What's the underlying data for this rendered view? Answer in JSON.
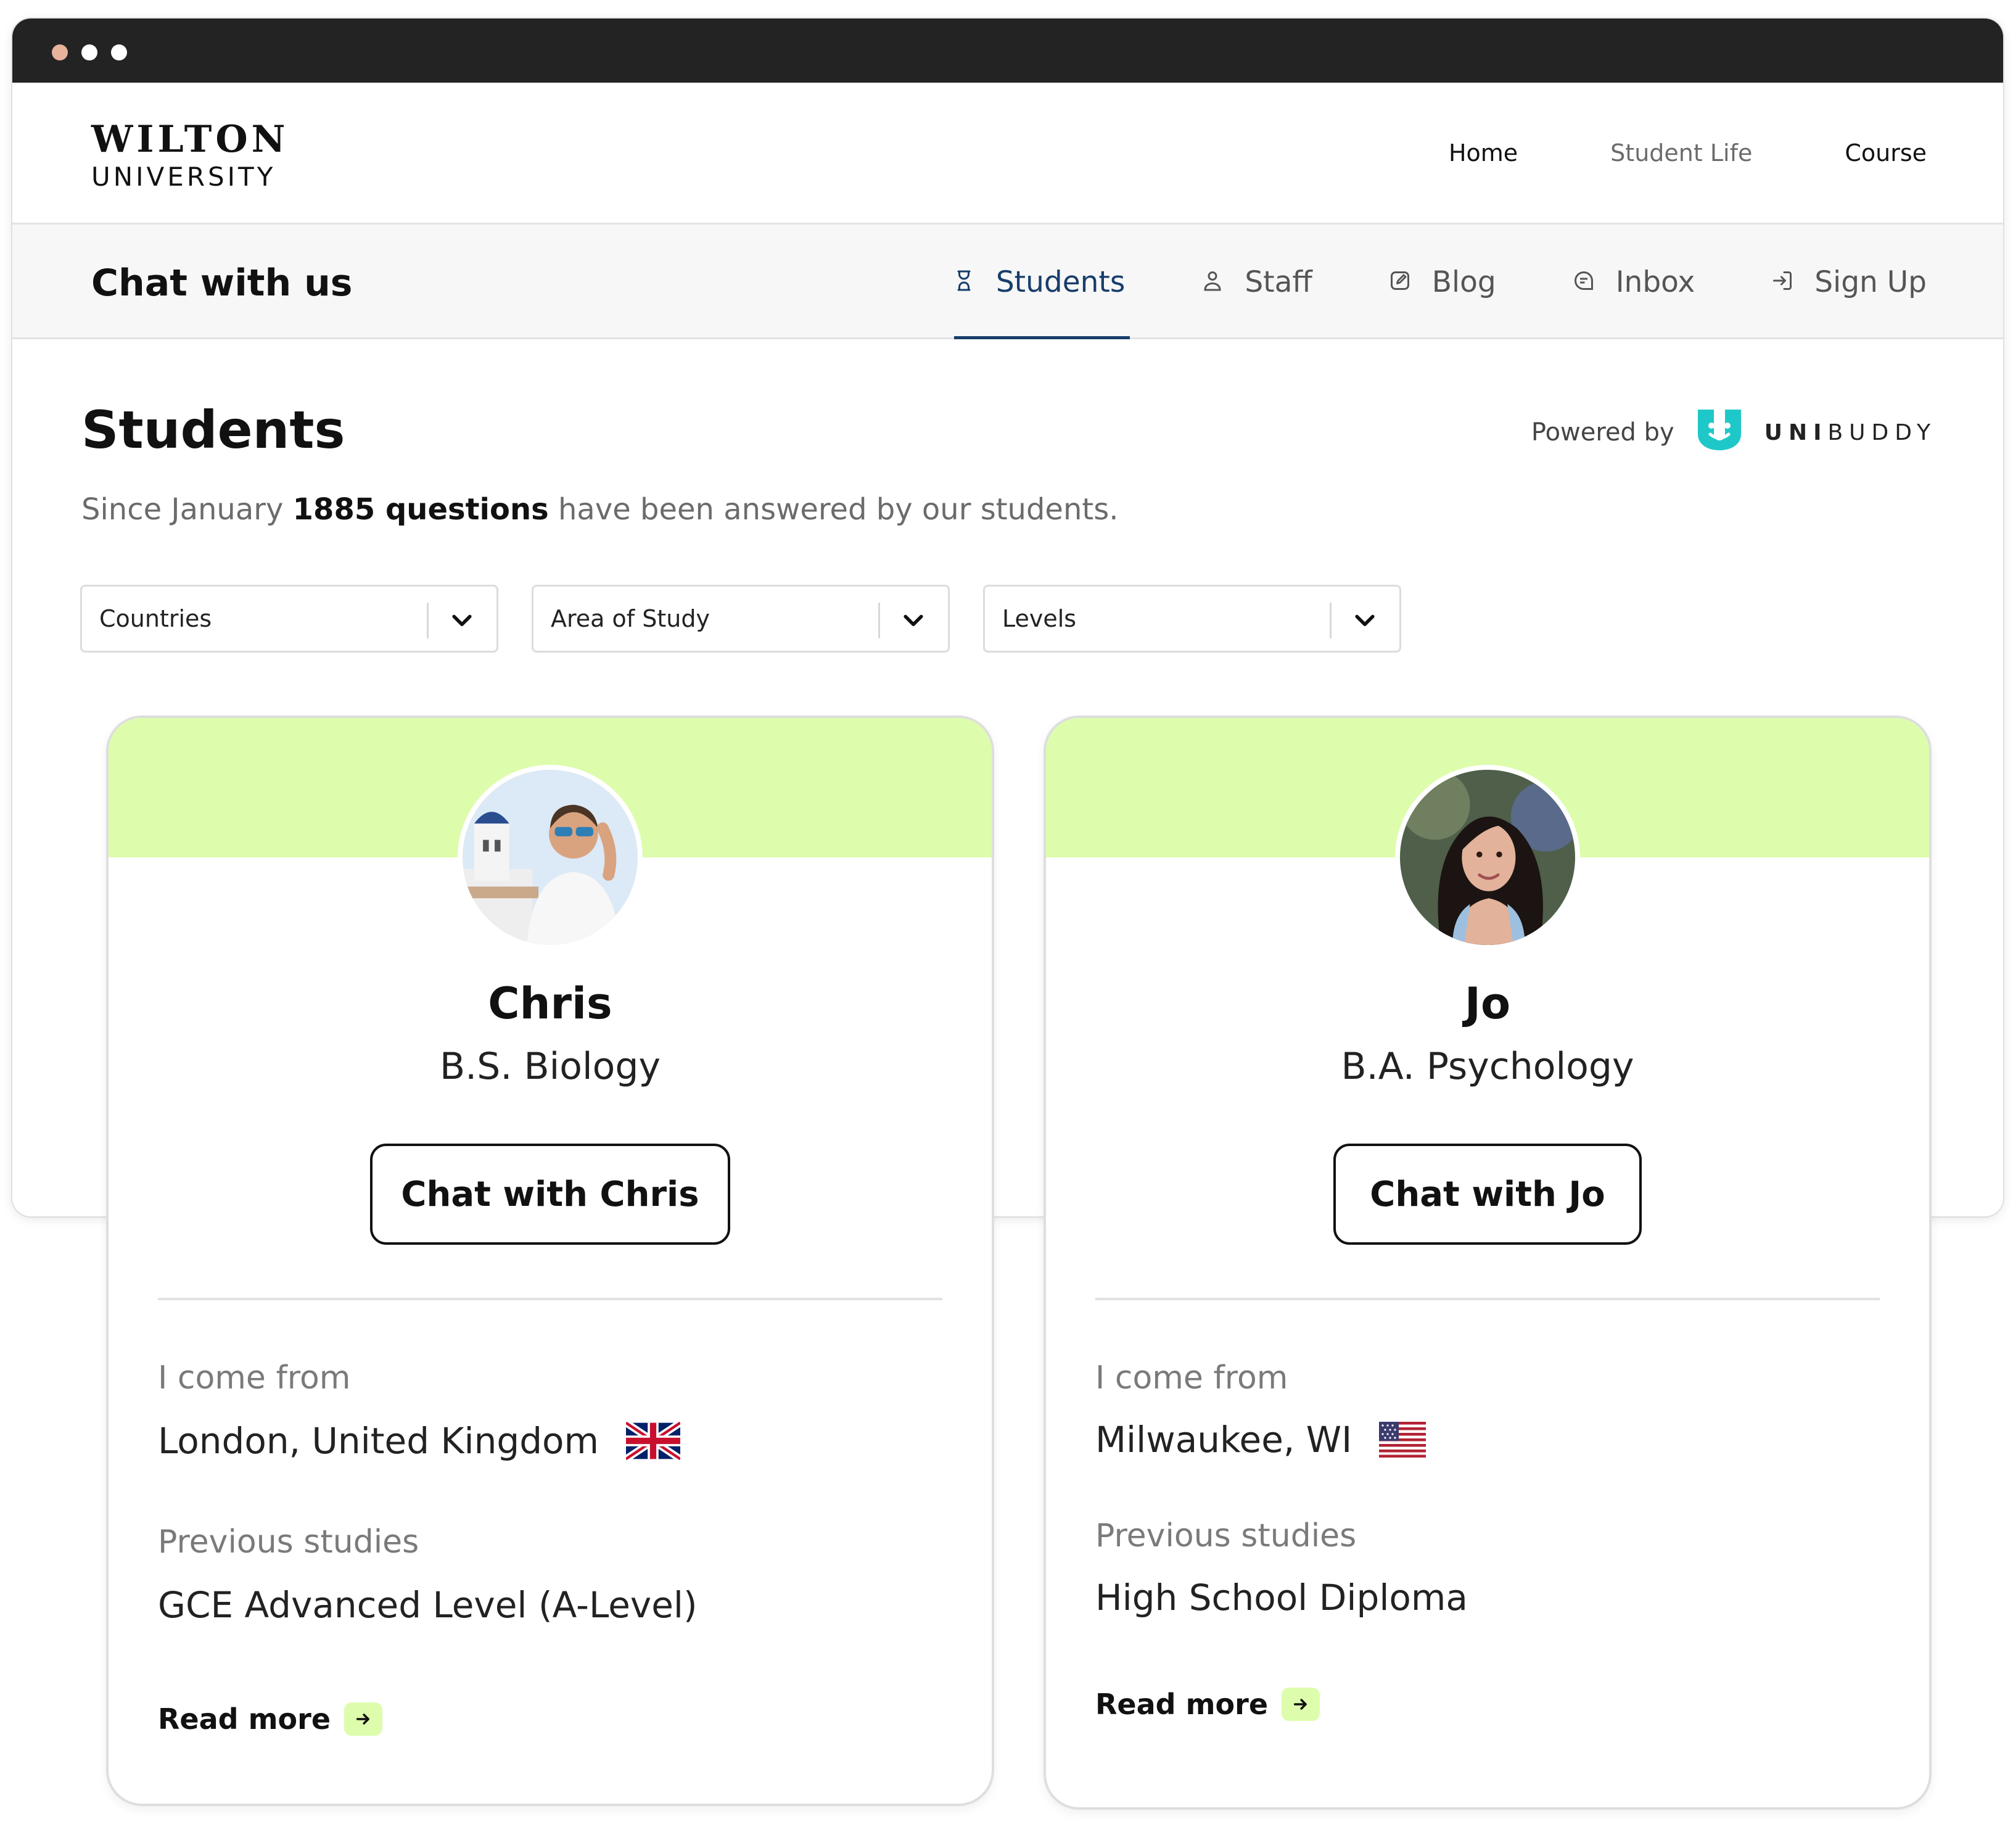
{
  "brand": {
    "name_line1": "WILTON",
    "name_line2": "UNIVERSITY"
  },
  "top_nav": {
    "items": [
      {
        "label": "Home"
      },
      {
        "label": "Student Life"
      },
      {
        "label": "Course"
      }
    ]
  },
  "chat_bar": {
    "title": "Chat with us",
    "tabs": [
      {
        "label": "Students",
        "icon": "hourglass-icon",
        "active": true
      },
      {
        "label": "Staff",
        "icon": "person-icon",
        "active": false
      },
      {
        "label": "Blog",
        "icon": "edit-icon",
        "active": false
      },
      {
        "label": "Inbox",
        "icon": "chat-bubble-icon",
        "active": false
      },
      {
        "label": "Sign Up",
        "icon": "sign-in-icon",
        "active": false
      }
    ],
    "active_color": "#173d6b"
  },
  "students": {
    "title": "Students",
    "powered_by": "Powered by",
    "provider_bold": "UNI",
    "provider_rest": "BUDDY",
    "provider_color": "#1ec8c8",
    "subtitle_prefix": "Since January",
    "subtitle_highlight": "1885 questions",
    "subtitle_suffix": "have been answered by our students."
  },
  "filters": [
    {
      "label": "Countries"
    },
    {
      "label": "Area of Study"
    },
    {
      "label": "Levels"
    }
  ],
  "cards": [
    {
      "name": "Chris",
      "degree": "B.S. Biology",
      "chat_label": "Chat with Chris",
      "from_label": "I come from",
      "from_value": "London, United Kingdom",
      "flag": "uk-flag-icon",
      "studies_label": "Previous studies",
      "studies_value": "GCE Advanced Level (A-Level)",
      "read_more": "Read more"
    },
    {
      "name": "Jo",
      "degree": "B.A. Psychology",
      "chat_label": "Chat with Jo",
      "from_label": "I come from",
      "from_value": "Milwaukee, WI",
      "flag": "us-flag-icon",
      "studies_label": "Previous studies",
      "studies_value": "High School Diploma",
      "read_more": "Read more"
    }
  ],
  "accent_color": "#ddfdac"
}
